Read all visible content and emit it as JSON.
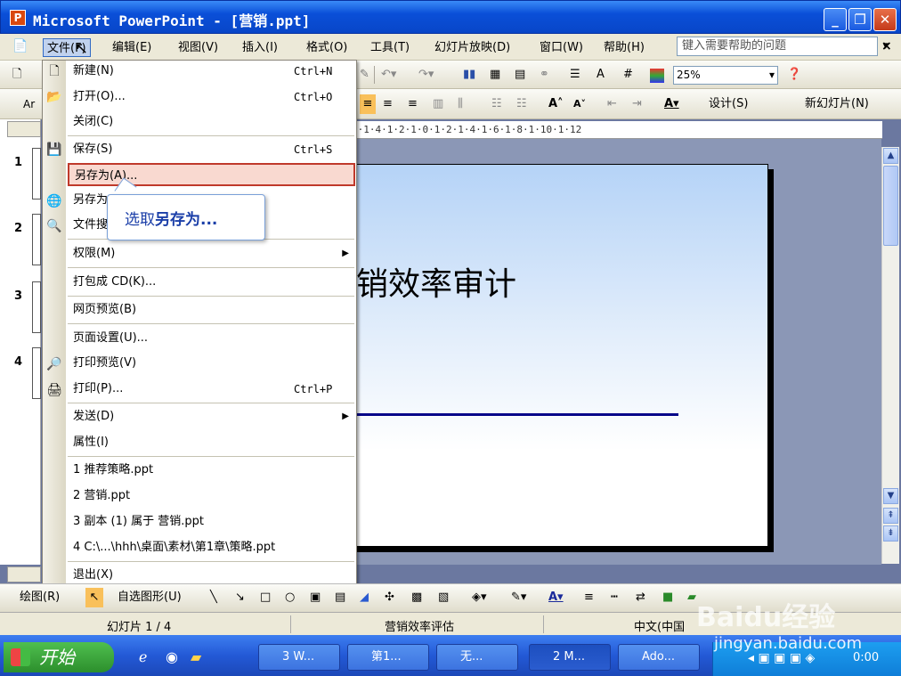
{
  "window": {
    "title": "Microsoft PowerPoint - [营销.ppt]",
    "app_icon": "P"
  },
  "menubar": {
    "items": [
      "文件(F)",
      "编辑(E)",
      "视图(V)",
      "插入(I)",
      "格式(O)",
      "工具(T)",
      "幻灯片放映(D)",
      "窗口(W)",
      "帮助(H)"
    ],
    "help_placeholder": "键入需要帮助的问题",
    "close": "×"
  },
  "toolbar1": {
    "zoom": "25%"
  },
  "toolbar2": {
    "design": "设计(S)",
    "new_slide": "新幻灯片(N)",
    "font_prefix": "Ar"
  },
  "ruler": {
    "text": "6·1·4·1·2·1·0·1·2·1·4·1·6·1·8·1·10·1·12"
  },
  "slides_pane": {
    "numbers": [
      "1",
      "2",
      "3",
      "4"
    ]
  },
  "slide": {
    "title": "销效率审计"
  },
  "file_menu": {
    "items": [
      {
        "label": "新建(N)",
        "shortcut": "Ctrl+N"
      },
      {
        "label": "打开(O)...",
        "shortcut": "Ctrl+O"
      },
      {
        "label": "关闭(C)",
        "shortcut": ""
      },
      {
        "label": "保存(S)",
        "shortcut": "Ctrl+S"
      },
      {
        "label": "另存为(A)...",
        "shortcut": ""
      },
      {
        "label": "另存为",
        "shortcut": ""
      },
      {
        "label": "文件搜",
        "shortcut": ""
      },
      {
        "label": "权限(M)",
        "shortcut": ""
      },
      {
        "label": "打包成 CD(K)...",
        "shortcut": ""
      },
      {
        "label": "网页预览(B)",
        "shortcut": ""
      },
      {
        "label": "页面设置(U)...",
        "shortcut": ""
      },
      {
        "label": "打印预览(V)",
        "shortcut": ""
      },
      {
        "label": "打印(P)...",
        "shortcut": "Ctrl+P"
      },
      {
        "label": "发送(D)",
        "shortcut": ""
      },
      {
        "label": "属性(I)",
        "shortcut": ""
      },
      {
        "label": "1 推荐策略.ppt",
        "shortcut": ""
      },
      {
        "label": "2 营销.ppt",
        "shortcut": ""
      },
      {
        "label": "3 副本 (1) 属于 营销.ppt",
        "shortcut": ""
      },
      {
        "label": "4 C:\\...\\hhh\\桌面\\素材\\第1章\\策略.ppt",
        "shortcut": ""
      },
      {
        "label": "退出(X)",
        "shortcut": ""
      }
    ]
  },
  "tooltip": {
    "prefix": "选取",
    "bold": "另存为..."
  },
  "drawbar": {
    "draw": "绘图(R)",
    "autoshapes": "自选图形(U)"
  },
  "status": {
    "slide": "幻灯片 1 / 4",
    "design": "营销效率评估",
    "lang": "中文(中国"
  },
  "taskbar": {
    "start": "开始",
    "tasks": [
      "3 W...",
      "第1...",
      "无...",
      "2 M...",
      "Ado..."
    ],
    "clock": "0:00"
  },
  "watermark": {
    "brand": "Baidu经验",
    "url": "jingyan.baidu.com"
  },
  "colors": {
    "titlebar": "#0a4fd8",
    "menu_highlight": "#f9d9d0",
    "highlight_border": "#c0392b",
    "tooltip_text": "#1a3ea8"
  }
}
